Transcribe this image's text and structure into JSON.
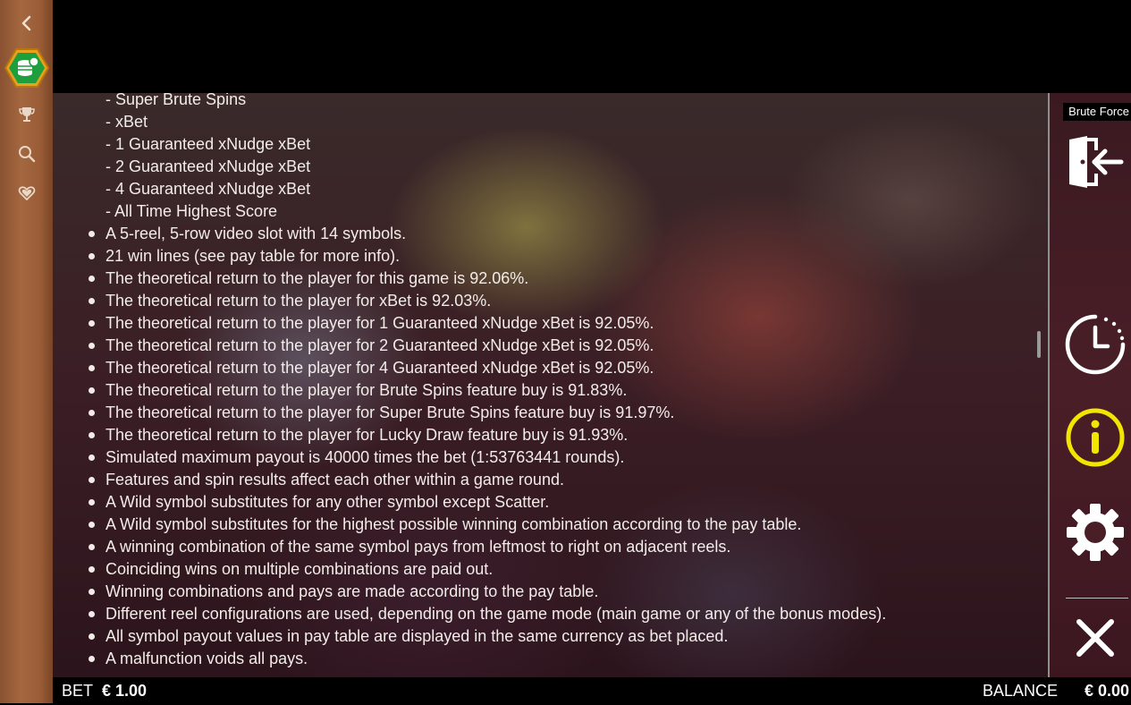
{
  "sidebar": {
    "icons": [
      "chevron-left-icon",
      "coins-icon",
      "trophy-icon",
      "search-icon",
      "heart-icon"
    ]
  },
  "info": {
    "sub_items": [
      "- Super Brute Spins",
      "- xBet",
      "- 1 Guaranteed xNudge xBet",
      "- 2 Guaranteed xNudge xBet",
      "- 4 Guaranteed xNudge xBet",
      "- All Time Highest Score"
    ],
    "bullets": [
      "A 5-reel, 5-row video slot with 14 symbols.",
      "21 win lines (see pay table for more info).",
      "The theoretical return to the player for this game is 92.06%.",
      "The theoretical return to the player for xBet is 92.03%.",
      "The theoretical return to the player for 1 Guaranteed xNudge xBet is 92.05%.",
      "The theoretical return to the player for 2 Guaranteed xNudge xBet is 92.05%.",
      "The theoretical return to the player for 4 Guaranteed xNudge xBet is 92.05%.",
      "The theoretical return to the player for Brute Spins feature buy is 91.83%.",
      "The theoretical return to the player for Super Brute Spins feature buy is 91.97%.",
      "The theoretical return to the player for Lucky Draw feature buy is 91.93%.",
      "Simulated maximum payout is 40000 times the bet (1:53763441 rounds).",
      "Features and spin results affect each other within a game round.",
      "A Wild symbol substitutes for any other symbol except Scatter.",
      "A Wild symbol substitutes for the highest possible winning combination according to the pay table.",
      "A winning combination of the same symbol pays from leftmost to right on adjacent reels.",
      "Coinciding wins on multiple combinations are paid out.",
      "Winning combinations and pays are made according to the pay table.",
      "Different reel configurations are used, depending on the game mode (main game or any of the bonus modes).",
      "All symbol payout values in pay table are displayed in the same currency as bet placed.",
      "A malfunction voids all pays."
    ]
  },
  "right_panel": {
    "game_title": "Brute Force",
    "buttons": [
      "exit-icon",
      "history-clock-icon",
      "info-icon",
      "settings-gear-icon",
      "close-icon"
    ]
  },
  "bottom_bar": {
    "bet_label": "BET",
    "bet_value": "€ 1.00",
    "balance_label": "BALANCE",
    "balance_value": "€ 0.00"
  },
  "colors": {
    "wood": "#a4673f",
    "info_accent": "#f2e600",
    "text": "#f2ece9",
    "panel_bg": "#4a1e27"
  }
}
